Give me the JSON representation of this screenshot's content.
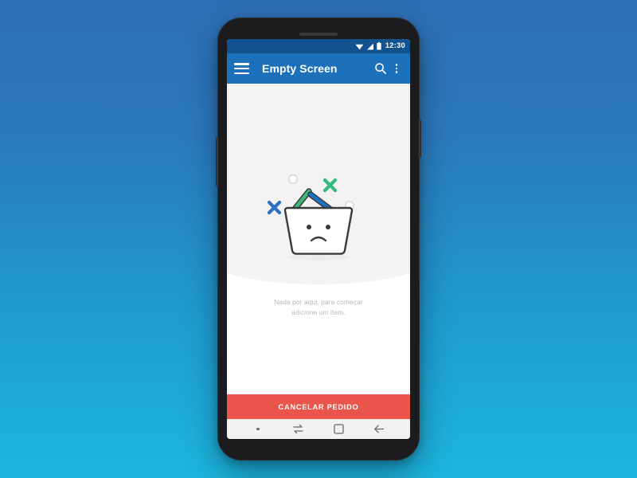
{
  "device": {
    "name": "android-phone-mockup",
    "frame_color": "#1c1c1e",
    "background_gradient_from": "#2d6fb5",
    "background_gradient_to": "#1cb6e0"
  },
  "status_bar": {
    "time": "12:30",
    "background": "#12538f",
    "icons": [
      "wifi-icon",
      "signal-icon",
      "battery-icon"
    ]
  },
  "app_bar": {
    "title": "Empty Screen",
    "background": "#1d71bb",
    "menu_icon": "hamburger-menu-icon",
    "search_icon": "search-icon",
    "overflow_icon": "overflow-menu-icon"
  },
  "content": {
    "backdrop_color": "#f4f2f2",
    "illustration": {
      "name": "sad-empty-basket-illustration",
      "basket_outline_color": "#3a3a3a",
      "basket_fill_color": "#ffffff",
      "stick_green_color": "#3cb878",
      "stick_blue_color": "#1b72c4",
      "x_mark_blue_color": "#2a6fc4",
      "x_mark_green_color": "#35b97f",
      "circle_outline_color": "#d8d6d6",
      "face": "sad-face"
    },
    "message_line_1": "Nada por aqui, para  começar",
    "message_line_2": "adicione um item.",
    "message_color": "#b7b5b5"
  },
  "cancel_button": {
    "label": "CANCELAR PEDIDO",
    "background": "#ea544a",
    "text_color": "#ffffff"
  },
  "nav_bar": {
    "background": "#f3f1f0",
    "icon_color": "#6a6a6a",
    "items": [
      {
        "name": "nav-dot-indicator",
        "icon": "dot-icon"
      },
      {
        "name": "nav-swap",
        "icon": "swap-arrows-icon"
      },
      {
        "name": "nav-recents",
        "icon": "square-recents-icon"
      },
      {
        "name": "nav-back",
        "icon": "back-arrow-icon"
      }
    ]
  }
}
